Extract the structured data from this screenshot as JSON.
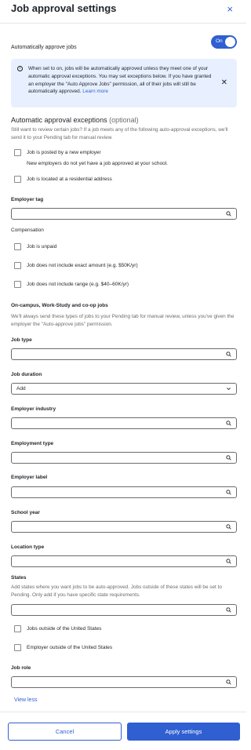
{
  "header": {
    "title": "Job approval settings",
    "close_label": "×"
  },
  "auto_approve": {
    "label": "Automatically approve jobs",
    "toggle_text": "On"
  },
  "info": {
    "text": "When set to on, jobs will be automatically approved unless they meet one of your automatic approval exceptions. You may set exceptions below. If you have granted an employer the \"Auto Approve Jobs\" permission, all of their jobs will still be automatically approved.",
    "link": "Learn more",
    "close_label": "✕"
  },
  "exceptions": {
    "title": "Automatic approval exceptions",
    "optional": "(optional)",
    "description": "Still want to review certain jobs? If a job meets any of the following auto-approval exceptions, we'll send it to your Pending tab for manual review.",
    "new_employer": "Job is posted by a new employer",
    "new_employer_sub": "New employers do not yet have a job approved at your school.",
    "residential": "Job is located at a residential address"
  },
  "employer_tag": {
    "label": "Employer tag"
  },
  "compensation": {
    "label": "Compensation",
    "unpaid": "Job is unpaid",
    "no_exact": "Job does not include exact amount (e.g. $50K/yr)",
    "no_range": "Job does not include range (e.g. $40–60K/yr)"
  },
  "oncampus": {
    "title": "On-campus, Work-Study and co-op jobs",
    "description": "We'll always send these types of jobs to your Pending tab for manual review, unless you've given the employer the \"Auto-approve jobs\" permission."
  },
  "fields": {
    "job_type": "Job type",
    "job_duration": "Job duration",
    "job_duration_value": "Add",
    "employer_industry": "Employer industry",
    "employment_type": "Employment type",
    "employer_label": "Employer label",
    "school_year": "School year",
    "location_type": "Location type",
    "states": "States",
    "states_desc": "Add states where you want jobs to be auto-approved. Jobs outside of these states will be set to Pending. Only add if you have specific state requirements.",
    "jobs_outside_us": "Jobs outside of the United States",
    "employer_outside_us": "Employer outside of the United States",
    "job_role": "Job role"
  },
  "view_less": "View less",
  "footer": {
    "cancel": "Cancel",
    "apply": "Apply settings"
  },
  "colors": {
    "accent": "#2f5fd1",
    "info_bg": "#e8f0ff"
  }
}
